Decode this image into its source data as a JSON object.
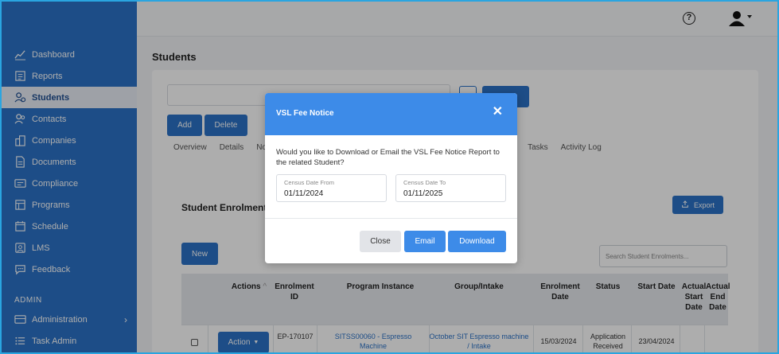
{
  "sidebar": {
    "items": [
      {
        "label": "Dashboard",
        "icon": "chart-line-icon"
      },
      {
        "label": "Reports",
        "icon": "report-icon"
      },
      {
        "label": "Students",
        "icon": "students-icon"
      },
      {
        "label": "Contacts",
        "icon": "contacts-icon"
      },
      {
        "label": "Companies",
        "icon": "companies-icon"
      },
      {
        "label": "Documents",
        "icon": "document-icon"
      },
      {
        "label": "Compliance",
        "icon": "compliance-icon"
      },
      {
        "label": "Programs",
        "icon": "programs-icon"
      },
      {
        "label": "Schedule",
        "icon": "schedule-icon"
      },
      {
        "label": "LMS",
        "icon": "lms-icon"
      },
      {
        "label": "Feedback",
        "icon": "feedback-icon"
      }
    ],
    "active_index": 2,
    "admin_section": "ADMIN",
    "admin_items": [
      {
        "label": "Administration",
        "icon": "administration-icon"
      },
      {
        "label": "Task Admin",
        "icon": "task-admin-icon"
      }
    ]
  },
  "topbar": {
    "help_glyph": "?",
    "user_icon": "user-icon"
  },
  "page": {
    "title": "Students",
    "add_label": "Add",
    "delete_label": "Delete",
    "tabs": [
      "Overview",
      "Details",
      "No",
      "Tasks",
      "Activity Log"
    ]
  },
  "enrolments": {
    "title": "Student Enrolments",
    "export_label": "Export",
    "new_label": "New",
    "search_placeholder": "Search Student Enrolments...",
    "columns": [
      "Actions",
      "Enrolment ID",
      "Program Instance",
      "Group/Intake",
      "Enrolment Date",
      "Status",
      "Start Date",
      "Actual Start Date",
      "Actual End Date"
    ],
    "rows": [
      {
        "action_label": "Action",
        "enrolment_id": "EP-170107",
        "program_instance": "SITSS00060 - Espresso Machine",
        "group_intake": "October SIT Espresso machine / Intake",
        "enrolment_date": "15/03/2024",
        "status": "Application Received",
        "start_date": "23/04/2024"
      }
    ]
  },
  "modal": {
    "title": "VSL Fee Notice",
    "close_glyph": "✕",
    "message": "Would you like to Download or Email the VSL Fee Notice Report to the related Student?",
    "census_from_label": "Census Date From",
    "census_from_value": "01/11/2024",
    "census_to_label": "Census Date To",
    "census_to_value": "01/11/2025",
    "close_label": "Close",
    "email_label": "Email",
    "download_label": "Download"
  },
  "colors": {
    "sidebar": "#2b72c7",
    "modal_header": "#3d8be8",
    "primary_button": "#3d8be8"
  }
}
